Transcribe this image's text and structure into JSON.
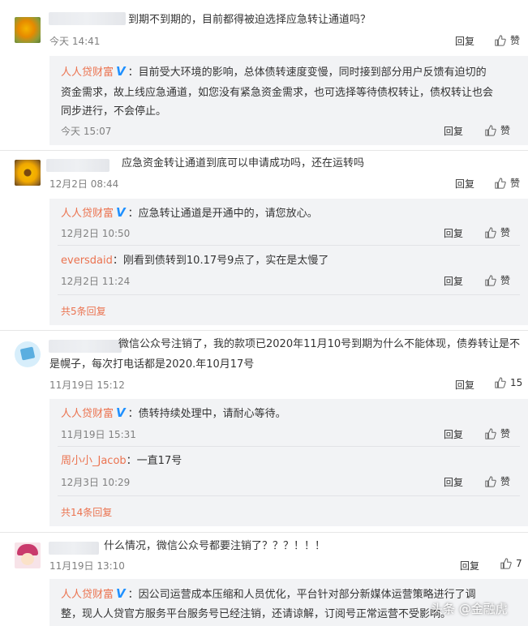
{
  "actions": {
    "reply": "回复",
    "like": "赞"
  },
  "comments": [
    {
      "text": "到期不到期的，目前都得被迫选择应急转让通道吗？",
      "time": "今天 14:41",
      "reply": {
        "name": "人人贷财富",
        "lines": [
          "目前受大环境的影响，总体债转速度变慢，同时接到部分用户反馈有迫切的",
          "资金需求，故上线应急通道，如您没有紧急资金需求，也可选择等待债权转让，债权转让也会",
          "同步进行，不会停止。"
        ],
        "time": "今天 15:07"
      }
    },
    {
      "text": "应急资金转让通道到底可以申请成功吗，还在运转吗",
      "time": "12月2日 08:44",
      "replies": [
        {
          "name": "人人贷财富",
          "text": "应急转让通道是开通中的，请您放心。",
          "time": "12月2日 10:50"
        },
        {
          "name": "eversdaid",
          "text": "刚看到债转到10.17号9点了，实在是太慢了",
          "time": "12月2日 11:24"
        }
      ],
      "more": "共5条回复"
    },
    {
      "lines": [
        "微信公众号注销了，我的款项已2020年11月10号到期为什么不能体现，债券转让是不",
        "是幌子，每次打电话都是2020.年10月17号"
      ],
      "time": "11月19日 15:12",
      "likes": "15",
      "replies": [
        {
          "name": "人人贷财富",
          "text": "债转持续处理中，请耐心等待。",
          "time": "11月19日 15:31"
        },
        {
          "name": "周小小_Jacob",
          "text": "一直17号",
          "time": "12月3日 10:29"
        }
      ],
      "more": "共14条回复"
    },
    {
      "text": "什么情况，微信公众号都要注销了？？？！！！",
      "time": "11月19日 13:10",
      "likes": "7",
      "reply": {
        "name": "人人贷财富",
        "lines": [
          "因公司运营成本压缩和人员优化，平台针对部分新媒体运营策略进行了调",
          "整，现人人贷官方服务平台服务号已经注销，还请谅解，订阅号正常运营不受影响。"
        ]
      }
    }
  ],
  "watermark": "头条 @金融虎"
}
